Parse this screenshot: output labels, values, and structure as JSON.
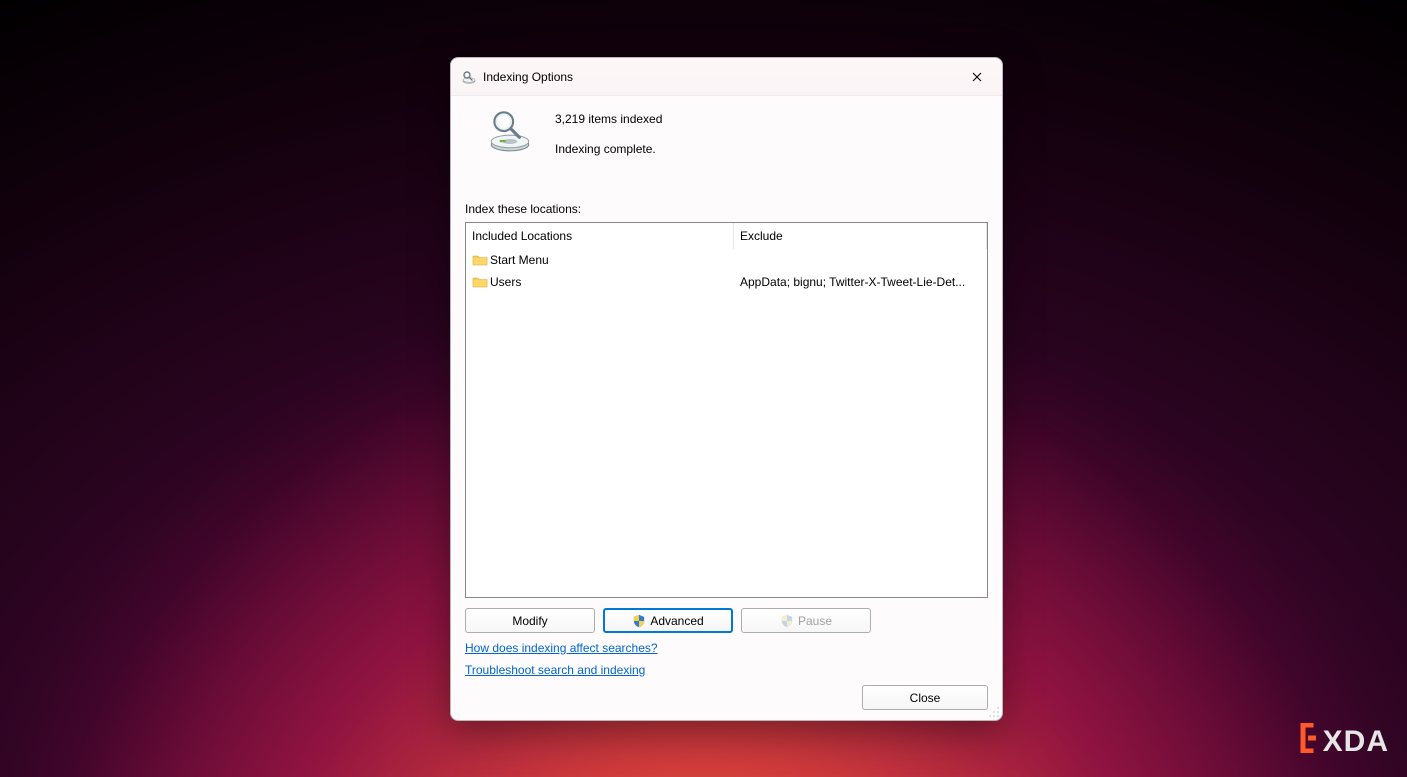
{
  "dialog": {
    "title": "Indexing Options",
    "status": {
      "count_text": "3,219 items indexed",
      "state_text": "Indexing complete."
    },
    "section_label": "Index these locations:",
    "columns": {
      "included": "Included Locations",
      "exclude": "Exclude"
    },
    "rows": [
      {
        "name": "Start Menu",
        "exclude": ""
      },
      {
        "name": "Users",
        "exclude": "AppData; bignu; Twitter-X-Tweet-Lie-Det..."
      }
    ],
    "buttons": {
      "modify": "Modify",
      "advanced": "Advanced",
      "pause": "Pause",
      "close": "Close"
    },
    "links": {
      "help": "How does indexing affect searches?",
      "troubleshoot": "Troubleshoot search and indexing"
    }
  },
  "watermark": {
    "text": "XDA"
  }
}
